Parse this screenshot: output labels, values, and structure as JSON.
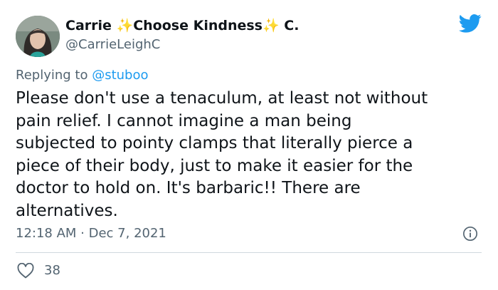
{
  "author": {
    "name_part1": "Carrie ",
    "sparkle1": "✨",
    "name_part2": "Choose Kindness",
    "sparkle2": "✨",
    "name_part3": " C.",
    "handle": "@CarrieLeighC",
    "avatar_icon": "profile-photo"
  },
  "reply": {
    "prefix": "Replying to ",
    "mention": "@stuboo"
  },
  "body_lines": [
    "Please don't use a tenaculum, at least not without",
    "pain relief. I cannot imagine a man being",
    "subjected to pointy clamps that literally pierce a",
    "piece of their body, just to make it easier for the",
    "doctor to hold on. It's barbaric!! There are",
    "alternatives."
  ],
  "meta": {
    "time": "12:18 AM",
    "separator": " · ",
    "date": "Dec 7, 2021"
  },
  "likes": {
    "count": "38"
  },
  "colors": {
    "brand": "#1d9bf0",
    "text": "#0f1419",
    "secondary": "#536471",
    "divider": "#cfd9de"
  },
  "icons": {
    "brand": "twitter-bird-icon",
    "info": "info-icon",
    "like": "heart-icon"
  }
}
